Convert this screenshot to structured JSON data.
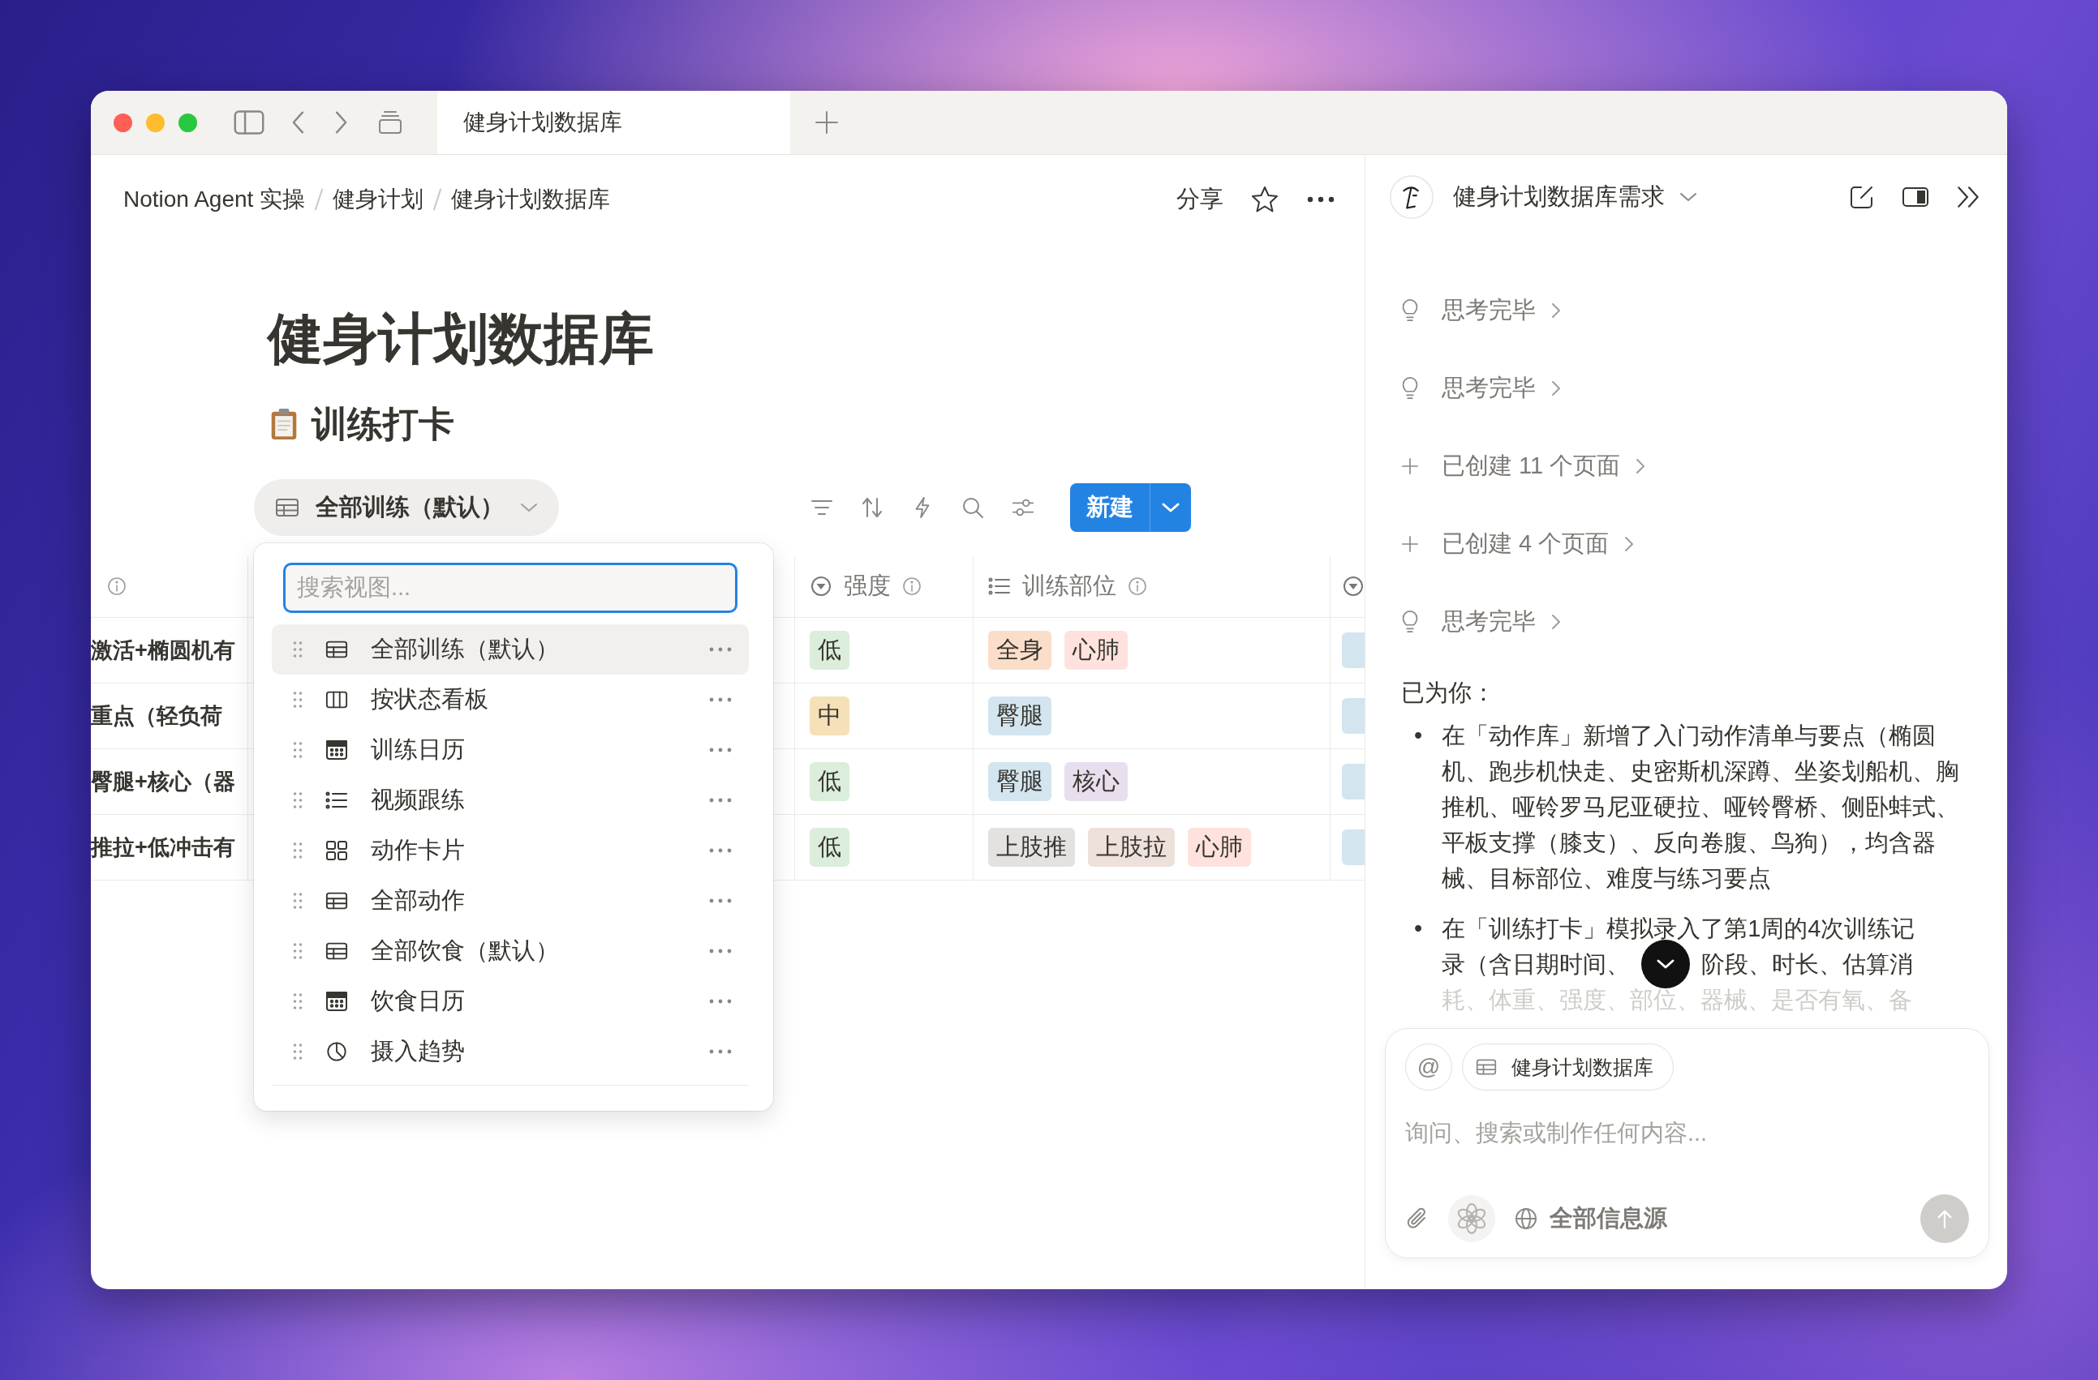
{
  "window": {
    "tab_title": "健身计划数据库"
  },
  "breadcrumb": [
    {
      "label": "Notion Agent 实操"
    },
    {
      "label": "健身计划"
    },
    {
      "label": "健身计划数据库"
    }
  ],
  "page_actions": {
    "share": "分享"
  },
  "page": {
    "title": "健身计划数据库",
    "database_title": "训练打卡"
  },
  "view_selector": {
    "label": "全部训练（默认）"
  },
  "new_button": {
    "label": "新建"
  },
  "table": {
    "columns": [
      {
        "label": "强度",
        "kind": "select"
      },
      {
        "label": "训练部位",
        "kind": "multi_select"
      }
    ],
    "rows": [
      {
        "column_1": "激活+椭圆机有",
        "intensity": {
          "label": "低",
          "color": "#dbeddb"
        },
        "body_parts": [
          {
            "label": "全身",
            "color": "#fadec9"
          },
          {
            "label": "心肺",
            "color": "#ffe2dd"
          }
        ]
      },
      {
        "column_1": "重点（轻负荷",
        "intensity": {
          "label": "中",
          "color": "#f5e0b8"
        },
        "body_parts": [
          {
            "label": "臀腿",
            "color": "#d3e5ef"
          }
        ]
      },
      {
        "column_1": "臀腿+核心（器",
        "intensity": {
          "label": "低",
          "color": "#dbeddb"
        },
        "body_parts": [
          {
            "label": "臀腿",
            "color": "#d3e5ef"
          },
          {
            "label": "核心",
            "color": "#e8deee"
          }
        ]
      },
      {
        "column_1": "推拉+低冲击有",
        "intensity": {
          "label": "低",
          "color": "#dbeddb"
        },
        "body_parts": [
          {
            "label": "上肢推",
            "color": "#e3e2e0"
          },
          {
            "label": "上肢拉",
            "color": "#eee0da"
          },
          {
            "label": "心肺",
            "color": "#ffe2dd"
          }
        ]
      }
    ]
  },
  "view_menu": {
    "search_placeholder": "搜索视图...",
    "items": [
      {
        "label": "全部训练（默认）",
        "kind": "table",
        "selected": true
      },
      {
        "label": "按状态看板",
        "kind": "board",
        "selected": false
      },
      {
        "label": "训练日历",
        "kind": "calendar",
        "selected": false
      },
      {
        "label": "视频跟练",
        "kind": "list",
        "selected": false
      },
      {
        "label": "动作卡片",
        "kind": "gallery",
        "selected": false
      },
      {
        "label": "全部动作",
        "kind": "table",
        "selected": false
      },
      {
        "label": "全部饮食（默认）",
        "kind": "table",
        "selected": false
      },
      {
        "label": "饮食日历",
        "kind": "calendar",
        "selected": false
      },
      {
        "label": "摄入趋势",
        "kind": "chart",
        "selected": false
      }
    ]
  },
  "agent_panel": {
    "title": "健身计划数据库需求",
    "steps": [
      {
        "kind": "thought",
        "label": "思考完毕"
      },
      {
        "kind": "thought",
        "label": "思考完毕"
      },
      {
        "kind": "created",
        "label": "已创建 11 个页面"
      },
      {
        "kind": "created",
        "label": "已创建 4 个页面"
      },
      {
        "kind": "thought",
        "label": "思考完毕"
      }
    ],
    "reply_intro": "已为你：",
    "bullet_marker_1": "•",
    "bullet_marker_2": "•",
    "bullet_1": "在「动作库」新增了入门动作清单与要点（椭圆机、跑步机快走、史密斯机深蹲、坐姿划船机、胸推机、哑铃罗马尼亚硬拉、哑铃臀桥、侧卧蚌式、平板支撑（膝支）、反向卷腹、鸟狗），均含器械、目标部位、难度与练习要点",
    "bullet_2": {
      "line_1": "在「训练打卡」模拟录入了第1周的4次训练记",
      "line_2_before": "录（含日期时间、",
      "line_2_after": "阶段、时长、估算消",
      "faded": "耗、体重、强度、部位、器械、是否有氧、备"
    }
  },
  "composer": {
    "mention": "@",
    "context_chip": "健身计划数据库",
    "placeholder": "询问、搜索或制作任何内容...",
    "sources": "全部信息源"
  }
}
